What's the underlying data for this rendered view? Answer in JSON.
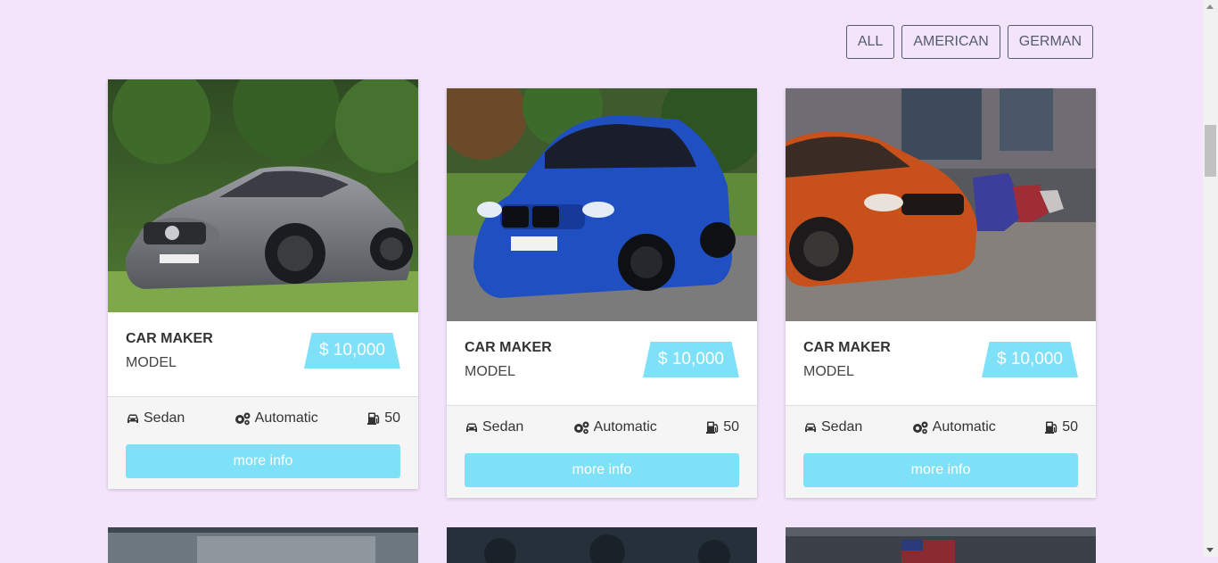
{
  "filters": [
    {
      "label": "ALL"
    },
    {
      "label": "AMERICAN"
    },
    {
      "label": "GERMAN"
    }
  ],
  "cards": [
    {
      "maker": "CAR MAKER",
      "model": "MODEL",
      "price": "$ 10,000",
      "body": "Sedan",
      "transmission": "Automatic",
      "fuel": "50",
      "button": "more info",
      "car_color": "gray"
    },
    {
      "maker": "CAR MAKER",
      "model": "MODEL",
      "price": "$ 10,000",
      "body": "Sedan",
      "transmission": "Automatic",
      "fuel": "50",
      "button": "more info",
      "car_color": "blue"
    },
    {
      "maker": "CAR MAKER",
      "model": "MODEL",
      "price": "$ 10,000",
      "body": "Sedan",
      "transmission": "Automatic",
      "fuel": "50",
      "button": "more info",
      "car_color": "orange"
    }
  ],
  "colors": {
    "background": "#f3e3fb",
    "accent": "#7fe1f7",
    "filter_border": "#555b6e"
  },
  "icons": {
    "body": "car-icon",
    "transmission": "gears-icon",
    "fuel": "gas-pump-icon"
  }
}
